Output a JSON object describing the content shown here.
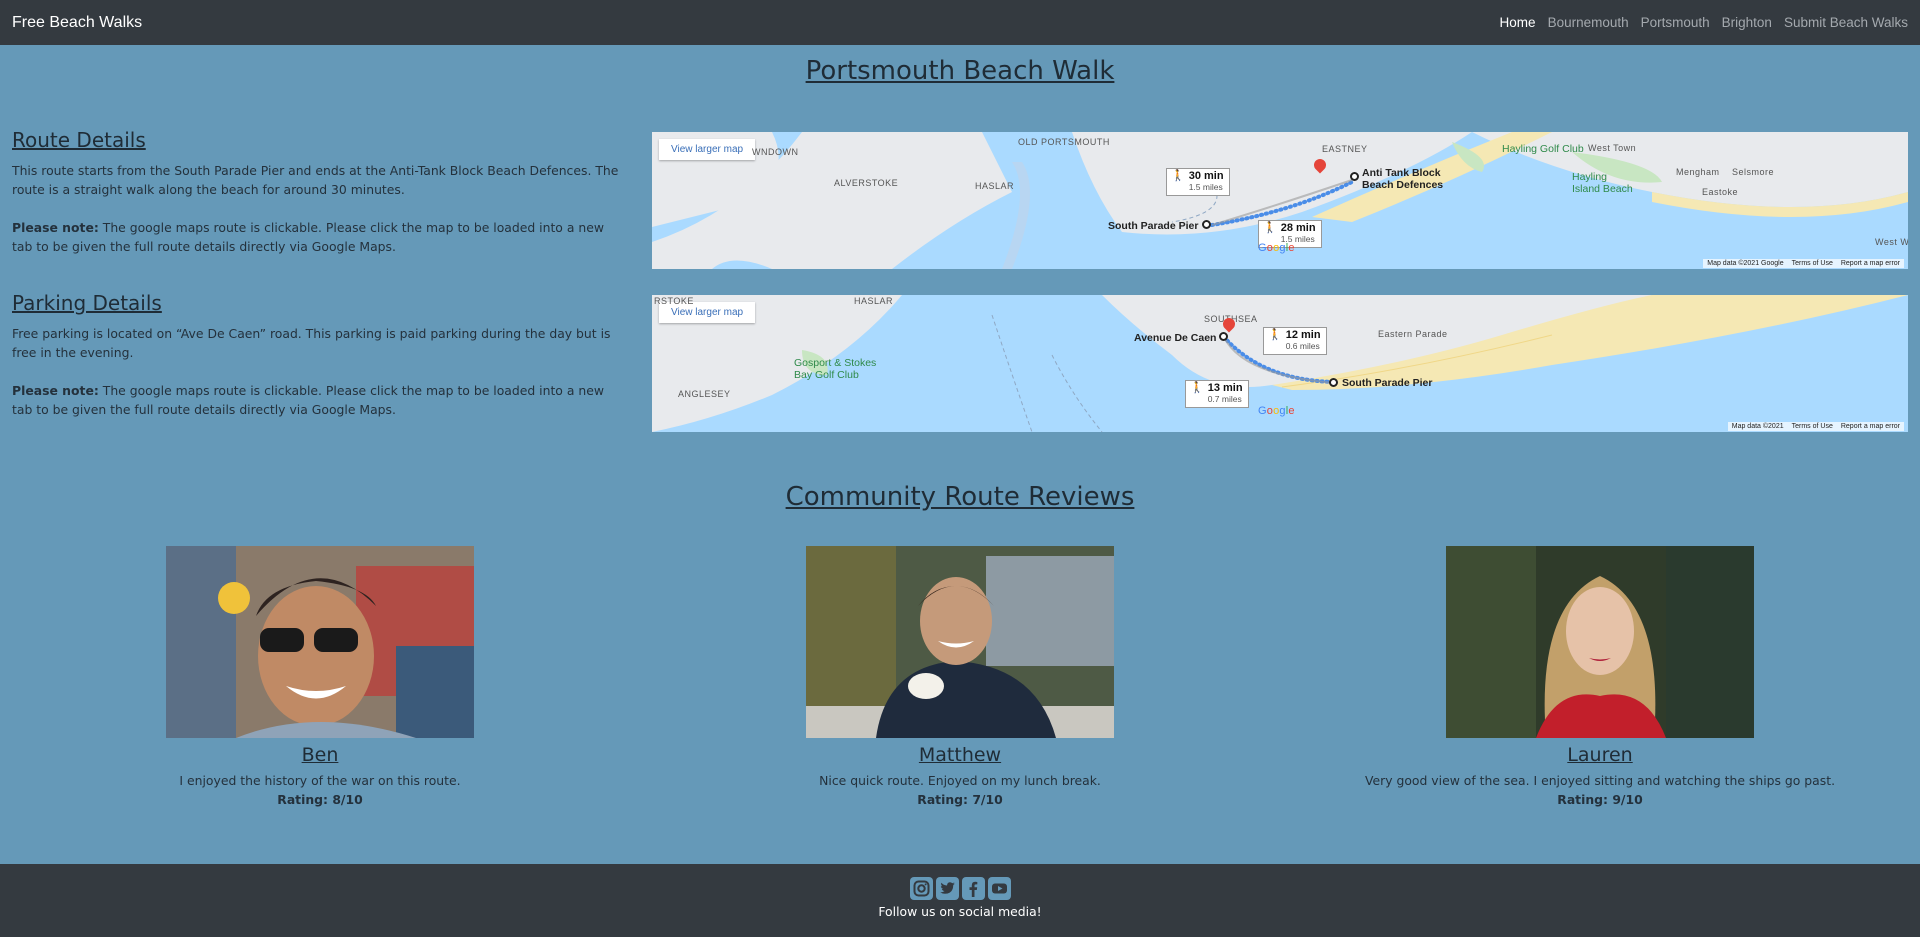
{
  "nav": {
    "brand": "Free Beach Walks",
    "links": [
      "Home",
      "Bournemouth",
      "Portsmouth",
      "Brighton",
      "Submit Beach Walks"
    ]
  },
  "page": {
    "title": "Portsmouth Beach Walk"
  },
  "route": {
    "heading": "Route Details",
    "text": "This route starts from the South Parade Pier and ends at the Anti-Tank Block Beach Defences. The route is a straight walk along the beach for around 30 minutes.",
    "note_label": "Please note:",
    "note_text": " The google maps route is clickable. Please click the map to be loaded into a new tab to be given the full route details directly via Google Maps."
  },
  "parking": {
    "heading": "Parking Details",
    "text": "Free parking is located on “Ave De Caen” road. This parking is paid parking during the day but is free in the evening.",
    "note_label": "Please note:",
    "note_text": " The google maps route is clickable. Please click the map to be loaded into a new tab to be given the full route details directly via Google Maps."
  },
  "map1": {
    "button": "View larger map",
    "areas": [
      "WNDOWN",
      "ALVERSTOKE",
      "HASLAR",
      "OLD PORTSMOUTH",
      "EASTNEY",
      "West Town",
      "Mengham",
      "Selsmore",
      "Eastoke",
      "West W"
    ],
    "golf1": "Hayling Golf Club",
    "golf2_line1": "Hayling",
    "golf2_line2": "Island Beach",
    "start": "South Parade Pier",
    "end_line1": "Anti Tank Block",
    "end_line2": "Beach Defences",
    "time1": "30 min",
    "dist1": "1.5 miles",
    "time2": "28 min",
    "dist2": "1.5 miles",
    "footer": [
      "Map data ©2021 Google",
      "Terms of Use",
      "Report a map error"
    ]
  },
  "map2": {
    "button": "View larger map",
    "areas": [
      "RSTOKE",
      "HASLAR",
      "ANGLESEY",
      "SOUTHSEA",
      "Eastern Parade"
    ],
    "golf_line1": "Gosport & Stokes",
    "golf_line2": "Bay Golf Club",
    "start": "Avenue De Caen",
    "end": "South Parade Pier",
    "time1": "12 min",
    "dist1": "0.6 miles",
    "time2": "13 min",
    "dist2": "0.7 miles",
    "footer": [
      "Map data ©2021",
      "Terms of Use",
      "Report a map error"
    ]
  },
  "google_logo": "Google",
  "reviews": {
    "title": "Community Route Reviews",
    "items": [
      {
        "name": "Ben",
        "text": "I enjoyed the history of the war on this route.",
        "rating": "Rating: 8/10"
      },
      {
        "name": "Matthew",
        "text": "Nice quick route. Enjoyed on my lunch break.",
        "rating": "Rating: 7/10"
      },
      {
        "name": "Lauren",
        "text": "Very good view of the sea. I enjoyed sitting and watching the ships go past.",
        "rating": "Rating: 9/10"
      }
    ]
  },
  "footer": {
    "icons": [
      "instagram-icon",
      "twitter-icon",
      "facebook-icon",
      "youtube-icon"
    ],
    "text": "Follow us on social media!"
  },
  "colors": {
    "page_bg": "#6599b8",
    "navbar_bg": "#343a40",
    "footer_bg": "#343a40",
    "water": "#aadaff",
    "land": "#e8eaed",
    "route": "#4a8de8"
  }
}
